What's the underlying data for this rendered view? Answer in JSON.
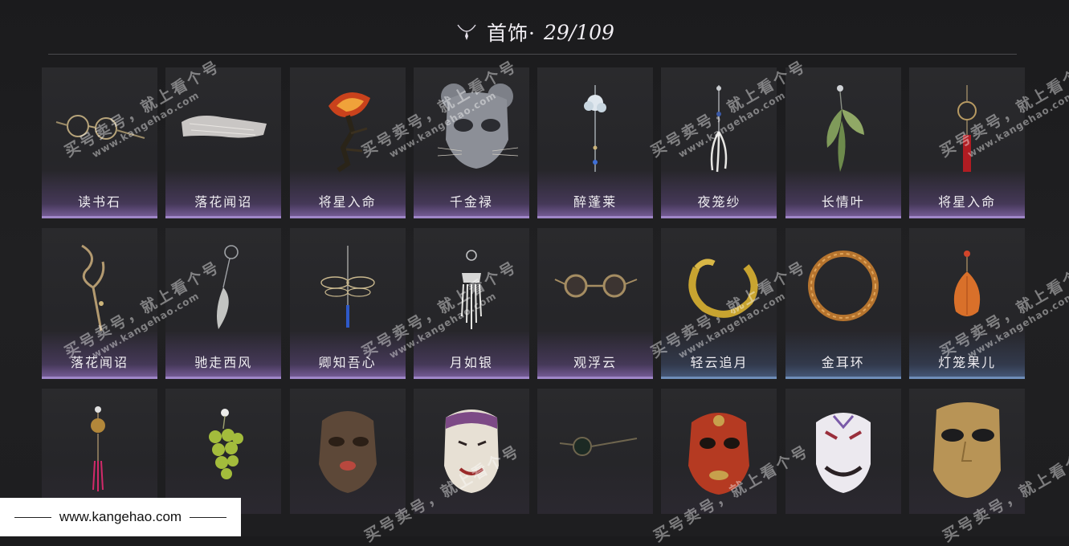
{
  "header": {
    "icon": "necklace-icon",
    "title": "首饰·",
    "count": "29/109"
  },
  "rows": [
    [
      {
        "label": "读书石",
        "icon": "spectacles-icon",
        "tint": "purple"
      },
      {
        "label": "落花闻诏",
        "icon": "white-fabric-icon",
        "tint": "purple"
      },
      {
        "label": "将星入命",
        "icon": "phoenix-flame-icon",
        "tint": "purple"
      },
      {
        "label": "千金禄",
        "icon": "silver-mask-icon",
        "tint": "purple"
      },
      {
        "label": "醉蓬莱",
        "icon": "flower-hairpin-icon",
        "tint": "purple"
      },
      {
        "label": "夜笼纱",
        "icon": "feather-pendant-icon",
        "tint": "purple"
      },
      {
        "label": "长情叶",
        "icon": "leaf-pendant-icon",
        "tint": "purple"
      },
      {
        "label": "将星入命",
        "icon": "tassel-earring-icon",
        "tint": "purple"
      }
    ],
    [
      {
        "label": "落花闻诏",
        "icon": "antler-hairpin-icon",
        "tint": "purple"
      },
      {
        "label": "驰走西风",
        "icon": "fang-earring-icon",
        "tint": "purple"
      },
      {
        "label": "卿知吾心",
        "icon": "dragonfly-pendant-icon",
        "tint": "purple"
      },
      {
        "label": "月如银",
        "icon": "silver-tassel-icon",
        "tint": "purple"
      },
      {
        "label": "观浮云",
        "icon": "round-glasses-icon",
        "tint": "purple"
      },
      {
        "label": "轻云追月",
        "icon": "gold-serpent-ring-icon",
        "tint": "blue"
      },
      {
        "label": "金耳环",
        "icon": "gold-hoop-icon",
        "tint": "blue"
      },
      {
        "label": "灯笼果儿",
        "icon": "lantern-fruit-icon",
        "tint": "blue"
      }
    ],
    [
      {
        "label": "",
        "icon": "red-tassel-charm-icon",
        "tint": "none"
      },
      {
        "label": "",
        "icon": "grape-earring-icon",
        "tint": "none"
      },
      {
        "label": "",
        "icon": "tiger-mask-icon",
        "tint": "none"
      },
      {
        "label": "",
        "icon": "opera-mask-icon",
        "tint": "none"
      },
      {
        "label": "",
        "icon": "dark-glasses-icon",
        "tint": "none"
      },
      {
        "label": "",
        "icon": "red-oni-mask-icon",
        "tint": "none"
      },
      {
        "label": "",
        "icon": "white-grin-mask-icon",
        "tint": "none"
      },
      {
        "label": "",
        "icon": "gold-half-mask-icon",
        "tint": "none"
      }
    ]
  ],
  "watermark": {
    "cn": "买号卖号，就上看个号",
    "url": "www.kangehao.com",
    "badge_small": "看个号"
  },
  "footer": {
    "url": "www.kangehao.com"
  },
  "colors": {
    "background": "#1e1e20",
    "card": "#2a2a2d",
    "purple_accent": "#9f86c7",
    "blue_accent": "#6e8db8"
  }
}
